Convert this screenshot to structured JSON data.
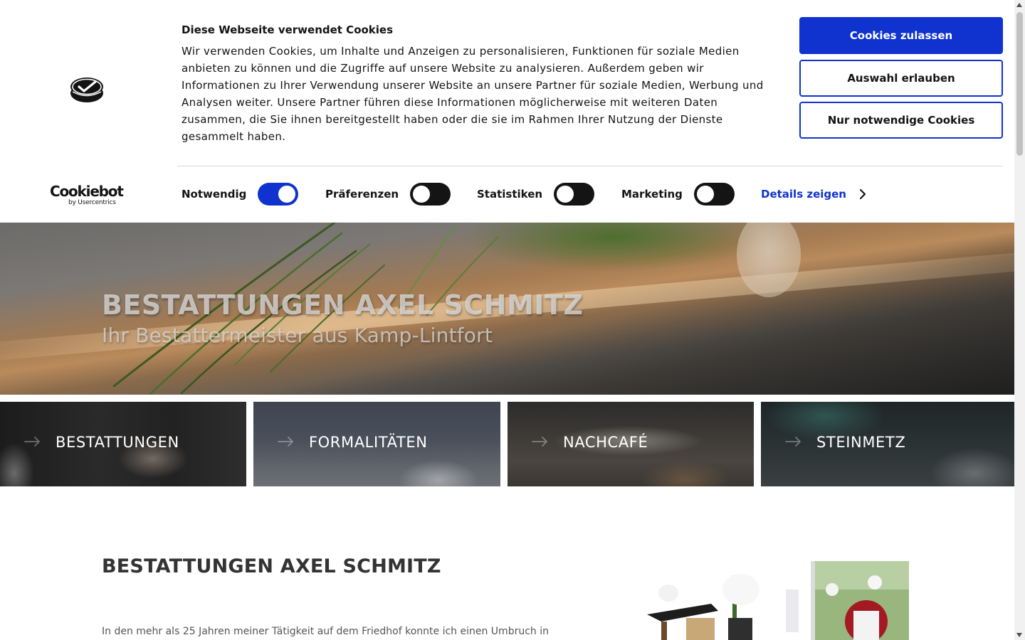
{
  "cookie_banner": {
    "brand": {
      "name": "Cookiebot",
      "byline": "by Usercentrics",
      "logo_icon": "cookiebot-logo-icon"
    },
    "title": "Diese Webseite verwendet Cookies",
    "text": "Wir verwenden Cookies, um Inhalte und Anzeigen zu personalisieren, Funktionen für soziale Medien anbieten zu können und die Zugriffe auf unsere Website zu analysieren. Außerdem geben wir Informationen zu Ihrer Verwendung unserer Website an unsere Partner für soziale Medien, Werbung und Analysen weiter. Unsere Partner führen diese Informationen möglicherweise mit weiteren Daten zusammen, die Sie ihnen bereitgestellt haben oder die sie im Rahmen Ihrer Nutzung der Dienste gesammelt haben.",
    "buttons": {
      "allow_all": "Cookies zulassen",
      "allow_selection": "Auswahl erlauben",
      "necessary_only": "Nur notwendige Cookies"
    },
    "toggles": [
      {
        "label": "Notwendig",
        "checked": true
      },
      {
        "label": "Präferenzen",
        "checked": false
      },
      {
        "label": "Statistiken",
        "checked": false
      },
      {
        "label": "Marketing",
        "checked": false
      }
    ],
    "details_link": "Details zeigen",
    "colors": {
      "accent": "#1032cf",
      "toggle_off": "#141414",
      "text": "#141414"
    }
  },
  "hero": {
    "title": "BESTATTUNGEN AXEL SCHMITZ",
    "subtitle": "Ihr Bestattermeister aus Kamp-Lintfort"
  },
  "tiles": [
    {
      "label": "BESTATTUNGEN",
      "icon": "arrow-right-icon"
    },
    {
      "label": "FORMALITÄTEN",
      "icon": "arrow-right-icon"
    },
    {
      "label": "NACHCAFÉ",
      "icon": "arrow-right-icon"
    },
    {
      "label": "STEINMETZ",
      "icon": "arrow-right-icon"
    }
  ],
  "content": {
    "heading": "BESTATTUNGEN AXEL SCHMITZ",
    "intro": "In den mehr als 25 Jahren meiner Tätigkeit auf dem Friedhof konnte ich einen Umbruch in"
  }
}
